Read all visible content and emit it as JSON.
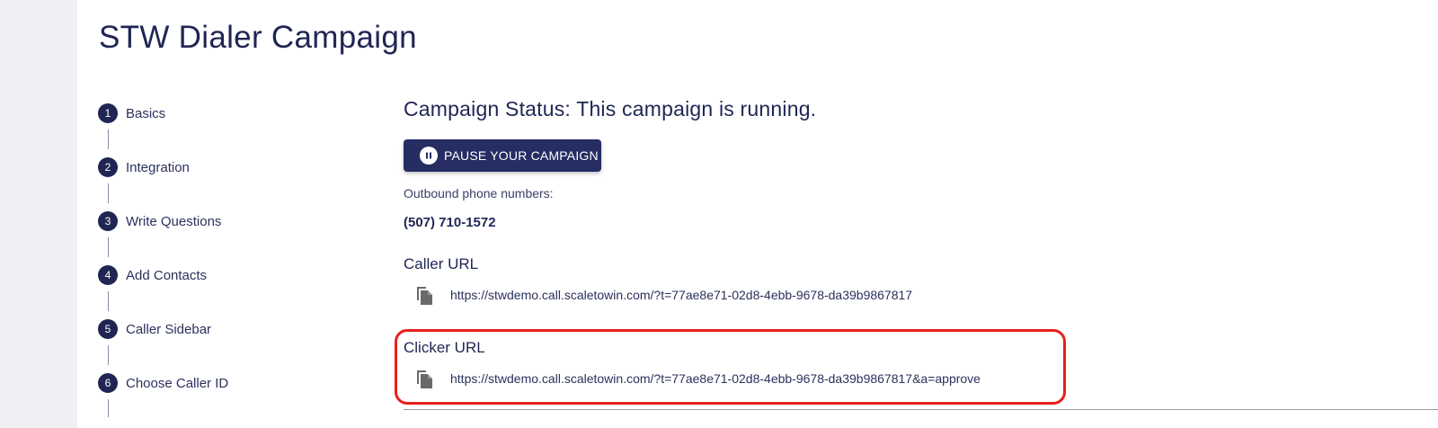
{
  "page_title": "STW Dialer Campaign",
  "steps": [
    {
      "number": "1",
      "label": "Basics"
    },
    {
      "number": "2",
      "label": "Integration"
    },
    {
      "number": "3",
      "label": "Write Questions"
    },
    {
      "number": "4",
      "label": "Add Contacts"
    },
    {
      "number": "5",
      "label": "Caller Sidebar"
    },
    {
      "number": "6",
      "label": "Choose Caller ID"
    }
  ],
  "main": {
    "status_heading": "Campaign Status: This campaign is running.",
    "pause_button_label": "PAUSE YOUR CAMPAIGN",
    "pause_icon": "pause-icon",
    "outbound_label": "Outbound phone numbers:",
    "phone_number": "(507) 710-1572",
    "caller_url_label": "Caller URL",
    "caller_url": "https://stwdemo.call.scaletowin.com/?t=77ae8e71-02d8-4ebb-9678-da39b9867817",
    "clicker_url_label": "Clicker URL",
    "clicker_url": "https://stwdemo.call.scaletowin.com/?t=77ae8e71-02d8-4ebb-9678-da39b9867817&a=approve",
    "copy_icon": "copy-icon"
  },
  "colors": {
    "primary": "#1f2654",
    "button": "#252d63",
    "highlight": "#e8201a",
    "rail": "#efeff4"
  }
}
